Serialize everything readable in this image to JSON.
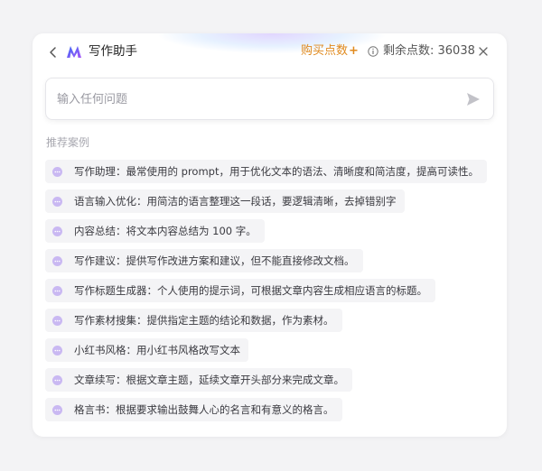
{
  "header": {
    "title": "写作助手",
    "buy_label": "购买点数",
    "buy_plus": "+",
    "remaining_label": "剩余点数: 36038",
    "accent_color": "#e08a1e"
  },
  "input": {
    "placeholder": "输入任何问题",
    "value": ""
  },
  "section": {
    "label": "推荐案例"
  },
  "suggestions": [
    "写作助理：最常使用的 prompt，用于优化文本的语法、清晰度和简洁度，提高可读性。",
    "语言输入优化：用简洁的语言整理这一段话，要逻辑清晰，去掉错别字",
    "内容总结：将文本内容总结为 100 字。",
    "写作建议：提供写作改进方案和建议，但不能直接修改文档。",
    "写作标题生成器：个人使用的提示词，可根据文章内容生成相应语言的标题。",
    "写作素材搜集：提供指定主题的结论和数据，作为素材。",
    "小红书风格：用小红书风格改写文本",
    "文章续写：根据文章主题，延续文章开头部分来完成文章。",
    "格言书：根据要求输出鼓舞人心的名言和有意义的格言。"
  ],
  "icons": {
    "back": "chevron-left-icon",
    "logo": "app-logo-icon",
    "info": "info-icon",
    "close": "close-icon",
    "send": "send-icon",
    "chip": "chat-bubble-icon"
  },
  "colors": {
    "chip_icon": "#c9b8f2",
    "send_icon": "#c2c2c8",
    "logo_blue": "#3b6cf6",
    "logo_purple": "#a855f7"
  }
}
